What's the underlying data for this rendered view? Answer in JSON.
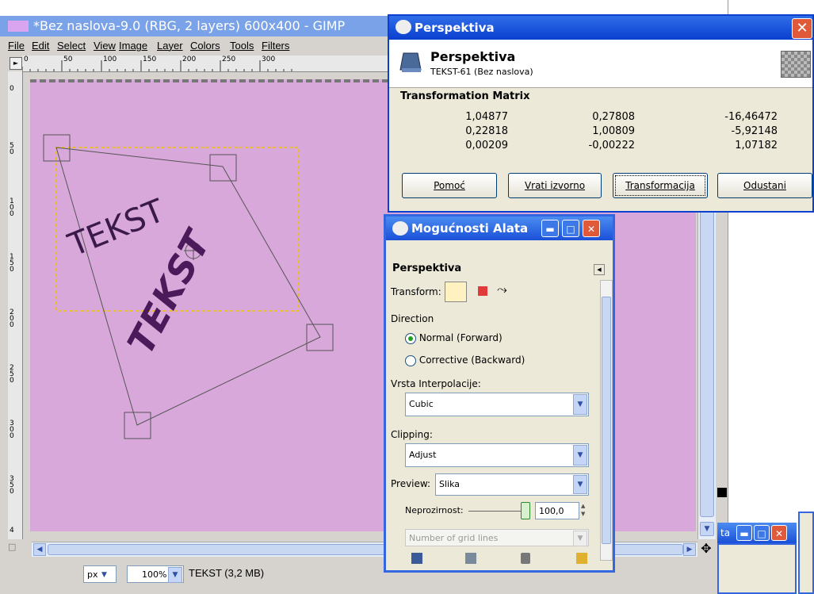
{
  "gimp": {
    "title": "*Bez naslova-9.0 (RBG, 2 layers) 600x400 - GIMP",
    "menu": [
      "File",
      "Edit",
      "Select",
      "View",
      "Image",
      "Layer",
      "Colors",
      "Tools",
      "Filters"
    ],
    "ruler_ticks": [
      "0",
      "50",
      "100",
      "150",
      "200",
      "250",
      "300"
    ],
    "vruler_ticks": [
      "0",
      "5\n0",
      "1\n0\n0",
      "1\n5\n0",
      "2\n0\n0",
      "2\n5\n0",
      "3\n0\n0",
      "3\n5\n0",
      "4"
    ],
    "canvas_text_1": "TEKST",
    "canvas_text_2": "TEKST",
    "status": {
      "unit": "px",
      "zoom": "100%",
      "info": "TEKST (3,2 MB)"
    }
  },
  "perspective_dialog": {
    "title": "Perspektiva",
    "heading": "Perspektiva",
    "subheading": "TEKST-61 (Bez naslova)",
    "matrix_label": "Transformation Matrix",
    "matrix": [
      [
        "1,04877",
        "0,27808",
        "-16,46472"
      ],
      [
        "0,22818",
        "1,00809",
        "-5,92148"
      ],
      [
        "0,00209",
        "-0,00222",
        "1,07182"
      ]
    ],
    "buttons": {
      "help": "Pomoć",
      "reset": "Vrati izvorno",
      "transform": "Transformacija",
      "cancel": "Odustani"
    }
  },
  "tool_options": {
    "title": "Mogućnosti Alata",
    "section": "Perspektiva",
    "transform_label": "Transform:",
    "direction_label": "Direction",
    "direction_normal": "Normal (Forward)",
    "direction_corrective": "Corrective (Backward)",
    "interp_label": "Vrsta Interpolacije:",
    "interp_value": "Cubic",
    "clipping_label": "Clipping:",
    "clipping_value": "Adjust",
    "preview_label": "Preview:",
    "preview_value": "Slika",
    "opacity_label": "Neprozirnost:",
    "opacity_value": "100,0",
    "grid_placeholder": "Number of grid lines"
  },
  "right_window": {
    "title": "ta"
  },
  "colors": {
    "canvas": "#d9a8da",
    "xp_blue": "#0a3fcf",
    "selection": "#f0c000"
  }
}
